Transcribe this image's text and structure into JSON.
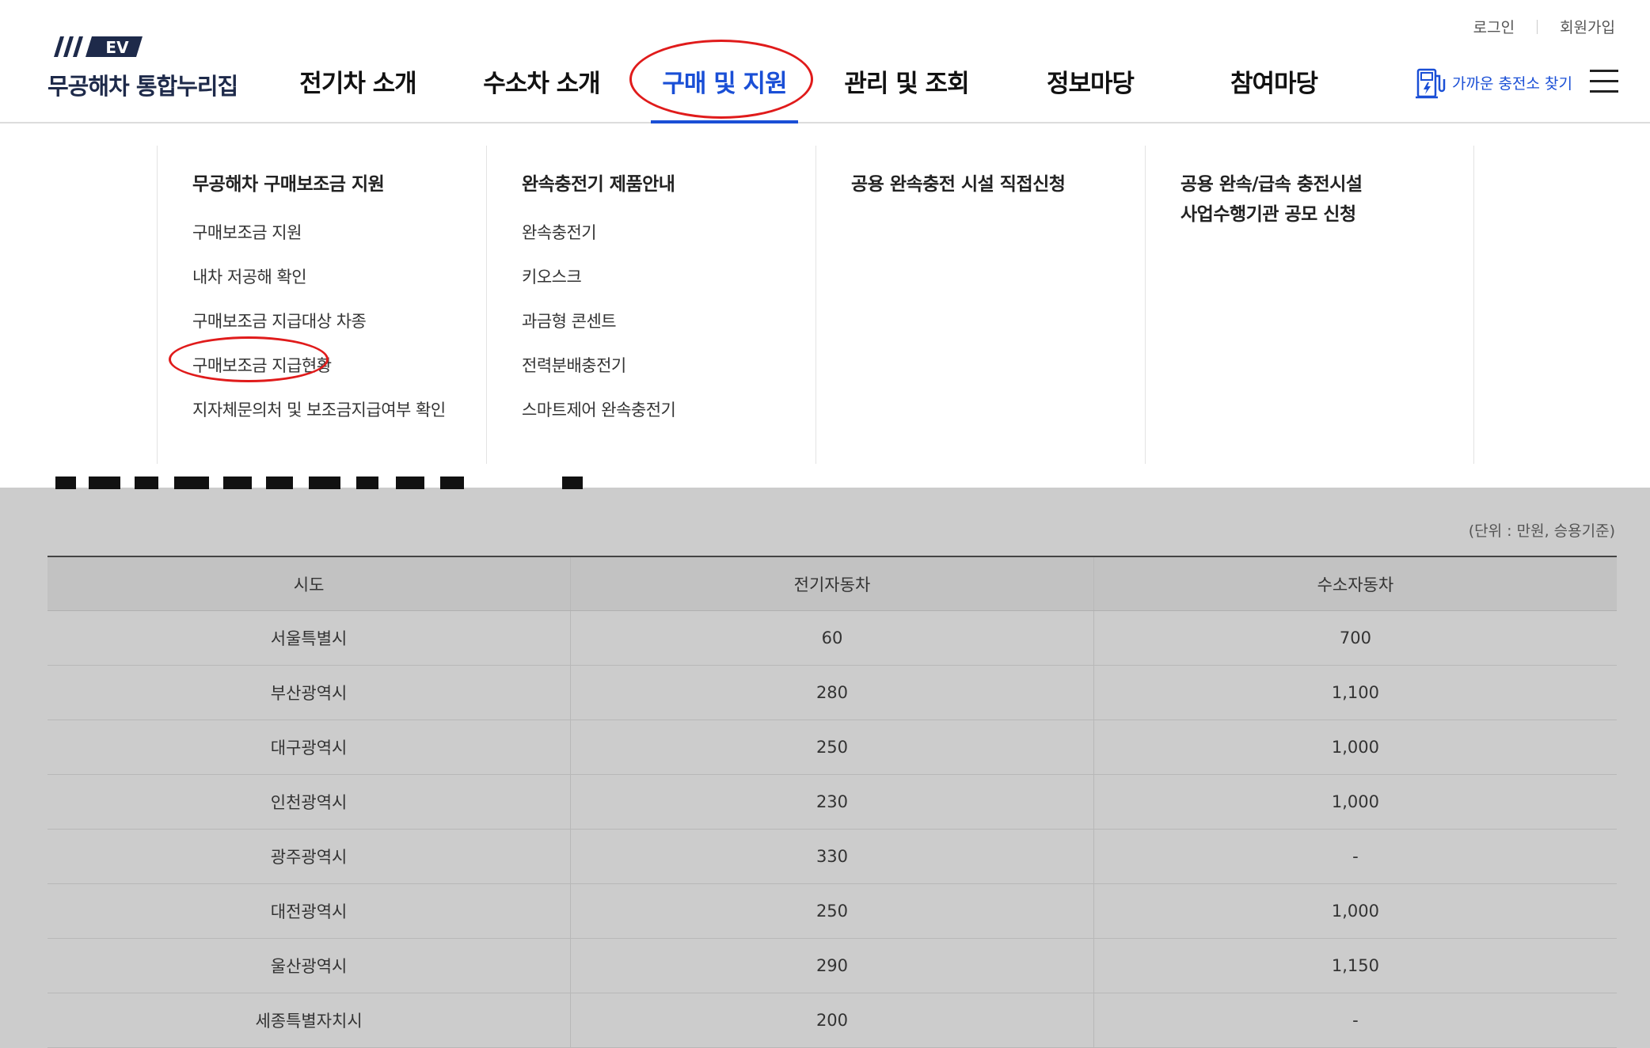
{
  "header": {
    "logo_badge": "EV",
    "logo_text": "무공해차 통합누리집",
    "util_login": "로그인",
    "util_signup": "회원가입",
    "nav": [
      "전기차 소개",
      "수소차 소개",
      "구매 및 지원",
      "관리 및 조회",
      "정보마당",
      "참여마당"
    ],
    "charger_find": "가까운 충전소 찾기"
  },
  "megamenu": {
    "col1": {
      "title": "무공해차 구매보조금 지원",
      "items": [
        "구매보조금 지원",
        "내차 저공해 확인",
        "구매보조금 지급대상 차종",
        "구매보조금 지급현황",
        "지자체문의처 및 보조금지급여부 확인"
      ]
    },
    "col2": {
      "title": "완속충전기 제품안내",
      "items": [
        "완속충전기",
        "키오스크",
        "과금형 콘센트",
        "전력분배충전기",
        "스마트제어 완속충전기"
      ]
    },
    "col3": {
      "title": "공용 완속충전 시설 직접신청"
    },
    "col4": {
      "title_line1": "공용 완속/급속 충전시설",
      "title_line2": "사업수행기관 공모 신청"
    }
  },
  "content": {
    "unit_note": "(단위 : 만원, 승용기준)",
    "table": {
      "headers": [
        "시도",
        "전기자동차",
        "수소자동차"
      ],
      "rows": [
        [
          "서울특별시",
          "60",
          "700"
        ],
        [
          "부산광역시",
          "280",
          "1,100"
        ],
        [
          "대구광역시",
          "250",
          "1,000"
        ],
        [
          "인천광역시",
          "230",
          "1,000"
        ],
        [
          "광주광역시",
          "330",
          "-"
        ],
        [
          "대전광역시",
          "250",
          "1,000"
        ],
        [
          "울산광역시",
          "290",
          "1,150"
        ],
        [
          "세종특별자치시",
          "200",
          "-"
        ]
      ]
    }
  },
  "colors": {
    "accent": "#1a4fd6",
    "annotation": "#e01b1b",
    "overlay": "#cccccc"
  }
}
